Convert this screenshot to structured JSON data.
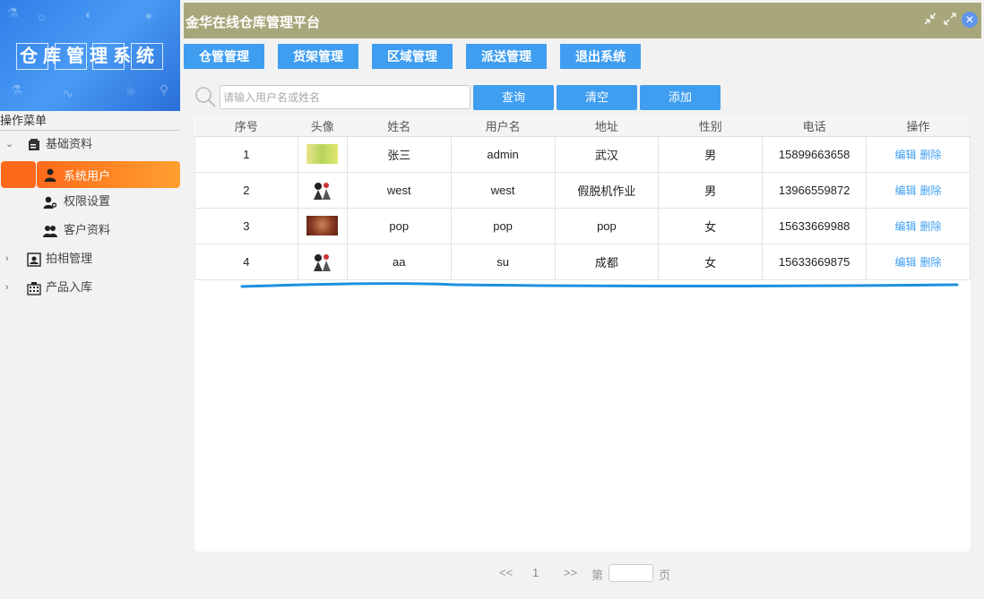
{
  "logo": {
    "title": "仓库管理系统"
  },
  "header": {
    "title": "金华在线仓库管理平台"
  },
  "nav": [
    {
      "label": "仓管管理"
    },
    {
      "label": "货架管理"
    },
    {
      "label": "区域管理"
    },
    {
      "label": "派送管理"
    },
    {
      "label": "退出系统"
    }
  ],
  "sidebar": {
    "title": "操作菜单",
    "groups": [
      {
        "label": "基础资料",
        "expanded": true,
        "icon": "document-icon"
      },
      {
        "label": "拍相管理",
        "expanded": false,
        "icon": "camera-icon"
      },
      {
        "label": "产品入库",
        "expanded": false,
        "icon": "building-icon"
      }
    ],
    "items": [
      {
        "label": "系统用户",
        "icon": "user-icon",
        "active": true
      },
      {
        "label": "权限设置",
        "icon": "key-user-icon"
      },
      {
        "label": "客户资料",
        "icon": "users-icon"
      }
    ]
  },
  "search": {
    "placeholder": "请输入用户名或姓名",
    "query_label": "查询",
    "clear_label": "清空",
    "add_label": "添加"
  },
  "table": {
    "columns": [
      "序号",
      "头像",
      "姓名",
      "用户名",
      "地址",
      "性别",
      "电话",
      "操作"
    ],
    "rows": [
      {
        "no": "1",
        "avatar": "green",
        "name": "张三",
        "username": "admin",
        "address": "武汉",
        "gender": "男",
        "phone": "15899663658"
      },
      {
        "no": "2",
        "avatar": "figure",
        "name": "west",
        "username": "west",
        "address": "假脱机作业",
        "gender": "男",
        "phone": "13966559872"
      },
      {
        "no": "3",
        "avatar": "brown",
        "name": "pop",
        "username": "pop",
        "address": "pop",
        "gender": "女",
        "phone": "15633669988"
      },
      {
        "no": "4",
        "avatar": "figure",
        "name": "aa",
        "username": "su",
        "address": "成都",
        "gender": "女",
        "phone": "15633669875"
      }
    ],
    "edit_label": "编辑",
    "delete_label": "删除"
  },
  "pager": {
    "prev": "<<",
    "current": "1",
    "next": ">>",
    "goto_prefix": "第",
    "goto_suffix": "页"
  },
  "colors": {
    "accent": "#3f9ef0",
    "header": "#a8a77b",
    "active": "#ff6a1a"
  }
}
